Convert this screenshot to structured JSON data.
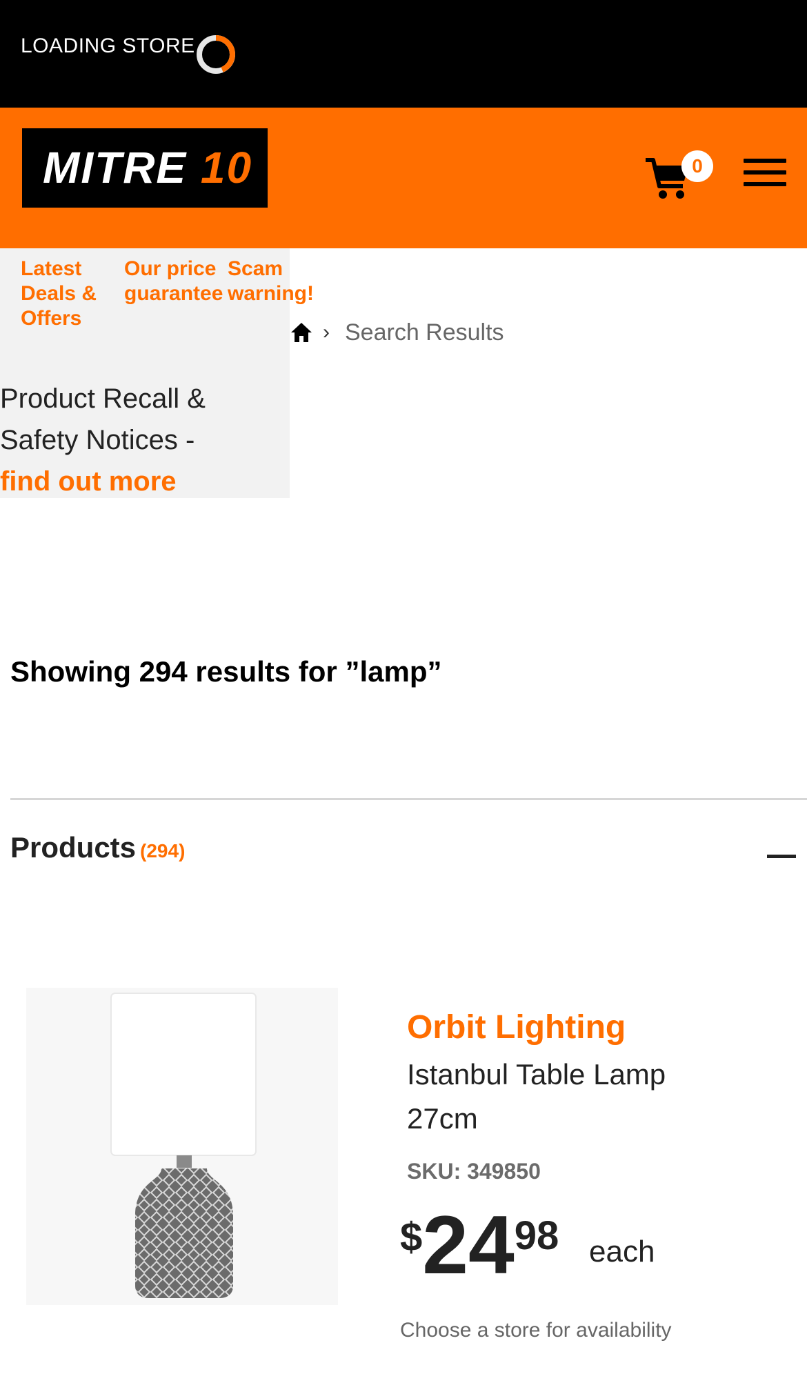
{
  "topbar": {
    "loading_text": "LOADING STORE"
  },
  "header": {
    "logo_main": "MITRE ",
    "logo_number": "10",
    "cart_count": "0",
    "brand_color": "#ff6e00"
  },
  "nav": {
    "links": [
      {
        "label_line1": "Latest",
        "label_line2": "Deals &",
        "label_line3": "Offers"
      },
      {
        "label_line1": "Our price",
        "label_line2": "guarantee"
      },
      {
        "label_line1": "Scam",
        "label_line2": "warning!"
      }
    ]
  },
  "recall": {
    "line1": "Product Recall &",
    "line2": "Safety Notices -",
    "link": "find out more"
  },
  "breadcrumb": {
    "separator": "›",
    "current": "Search Results"
  },
  "results": {
    "heading": "Showing 294 results for ”lamp”"
  },
  "products": {
    "heading": "Products",
    "count": "(294)"
  },
  "product": {
    "brand": "Orbit Lighting",
    "name_line1": "Istanbul Table Lamp",
    "name_line2": "27cm",
    "sku": "SKU: 349850",
    "price_symbol": "$",
    "price_dollars": "24",
    "price_cents": "98",
    "price_unit": "each",
    "availability": "Choose a store for availability"
  }
}
